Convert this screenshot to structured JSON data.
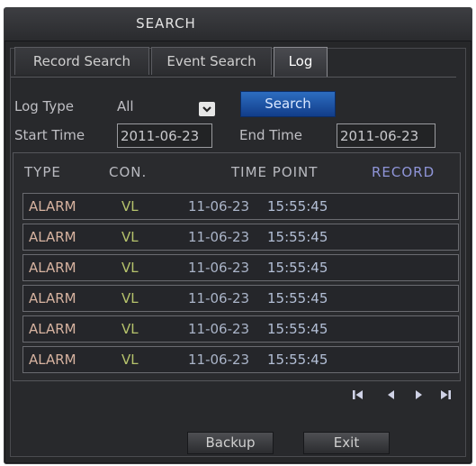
{
  "window": {
    "title": "SEARCH"
  },
  "tabs": [
    {
      "label": "Record Search"
    },
    {
      "label": "Event Search"
    },
    {
      "label": "Log"
    }
  ],
  "filters": {
    "log_type_label": "Log Type",
    "log_type_value": "All",
    "search_button": "Search",
    "start_time_label": "Start Time",
    "start_time_value": "2011-06-23",
    "end_time_label": "End Time",
    "end_time_value": "2011-06-23"
  },
  "table": {
    "headers": {
      "type": "TYPE",
      "con": "CON.",
      "time_point": "TIME POINT",
      "record": "RECORD"
    },
    "rows": [
      {
        "type": "ALARM",
        "con": "VL",
        "date": "11-06-23",
        "time": "15:55:45"
      },
      {
        "type": "ALARM",
        "con": "VL",
        "date": "11-06-23",
        "time": "15:55:45"
      },
      {
        "type": "ALARM",
        "con": "VL",
        "date": "11-06-23",
        "time": "15:55:45"
      },
      {
        "type": "ALARM",
        "con": "VL",
        "date": "11-06-23",
        "time": "15:55:45"
      },
      {
        "type": "ALARM",
        "con": "VL",
        "date": "11-06-23",
        "time": "15:55:45"
      },
      {
        "type": "ALARM",
        "con": "VL",
        "date": "11-06-23",
        "time": "15:55:45"
      }
    ]
  },
  "pager": {
    "icons": [
      "first-page-icon",
      "prev-page-icon",
      "next-page-icon",
      "last-page-icon"
    ]
  },
  "footer": {
    "backup_button": "Backup",
    "exit_button": "Exit"
  },
  "colors": {
    "accent_blue": "#1f5aa8",
    "window_bg": "#262729",
    "record_header": "#8f95d8"
  }
}
